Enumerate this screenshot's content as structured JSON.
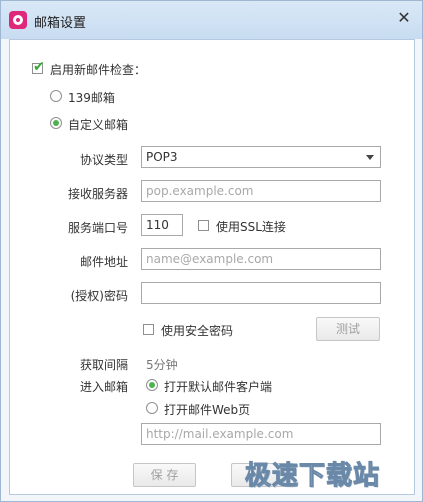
{
  "window": {
    "title": "邮箱设置",
    "close_glyph": "✕"
  },
  "enable_check": {
    "label": "启用新邮件检查：",
    "checked": true,
    "mark": "✔"
  },
  "mail_type": {
    "option_139": {
      "label": "139邮箱",
      "selected": false
    },
    "option_custom": {
      "label": "自定义邮箱",
      "selected": true
    }
  },
  "protocol": {
    "label": "协议类型",
    "value": "POP3"
  },
  "server": {
    "label": "接收服务器",
    "placeholder": "pop.example.com"
  },
  "port": {
    "label": "服务端口号",
    "value": "110",
    "ssl_label": "使用SSL连接"
  },
  "email": {
    "label": "邮件地址",
    "placeholder": "name@example.com"
  },
  "password": {
    "label": "(授权)密码",
    "value": ""
  },
  "secure_password": {
    "label": "使用安全密码"
  },
  "test_button": {
    "label": "测试"
  },
  "interval": {
    "label": "获取间隔",
    "value": "5分钟"
  },
  "enter_mailbox": {
    "label": "进入邮箱",
    "option_default_client": {
      "label": "打开默认邮件客户端",
      "selected": true
    },
    "option_web": {
      "label": "打开邮件Web页",
      "selected": false
    },
    "url_placeholder": "http://mail.example.com"
  },
  "buttons": {
    "save": "保 存",
    "cancel": "取"
  },
  "watermark": "极速下载站"
}
